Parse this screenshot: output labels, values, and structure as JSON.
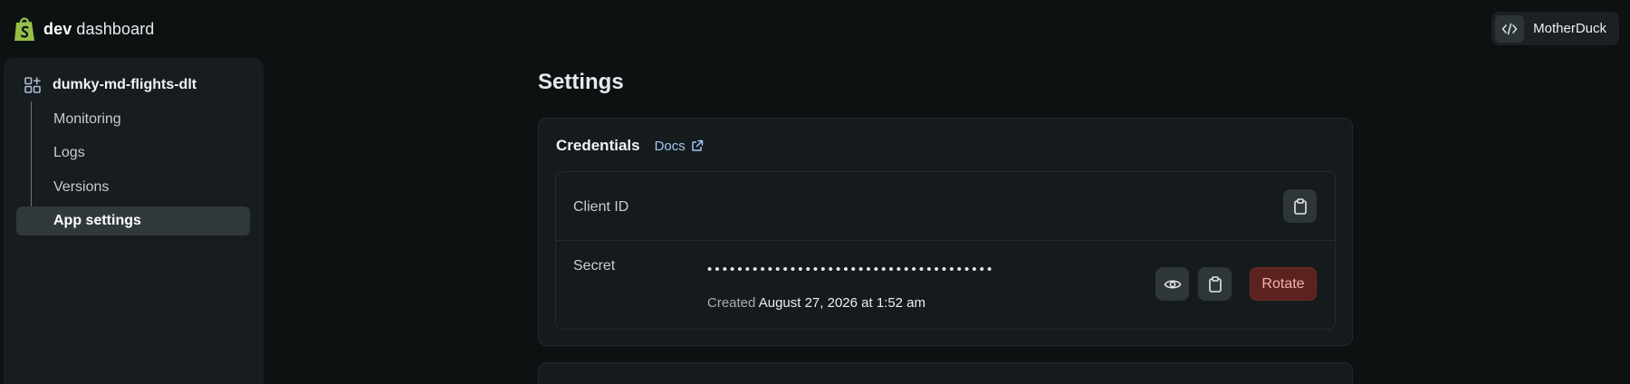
{
  "header": {
    "brand_bold": "dev",
    "brand_rest": " dashboard",
    "org_name": "MotherDuck"
  },
  "sidebar": {
    "app_name": "dumky-md-flights-dlt",
    "items": [
      {
        "label": "Monitoring"
      },
      {
        "label": "Logs"
      },
      {
        "label": "Versions"
      },
      {
        "label": "App settings",
        "active": true
      }
    ]
  },
  "main": {
    "title": "Settings",
    "credentials": {
      "title": "Credentials",
      "docs_label": "Docs",
      "client_id_label": "Client ID",
      "secret_label": "Secret",
      "secret_value": "••••••••••••••••••••••••••••••••••••••",
      "created_prefix": "Created ",
      "created_date": "August 27, 2026 at 1:52 am",
      "rotate_label": "Rotate"
    }
  },
  "colors": {
    "accent_link": "#9fc8ef",
    "danger_bg": "#5c2220",
    "danger_text": "#f2b4ae",
    "brand_green": "#95bf47"
  },
  "icons": {
    "brand": "shopify-bag-icon",
    "org": "code-icon",
    "app": "apps-grid-icon",
    "docs": "external-link-icon",
    "copy": "clipboard-icon",
    "reveal": "eye-icon"
  }
}
